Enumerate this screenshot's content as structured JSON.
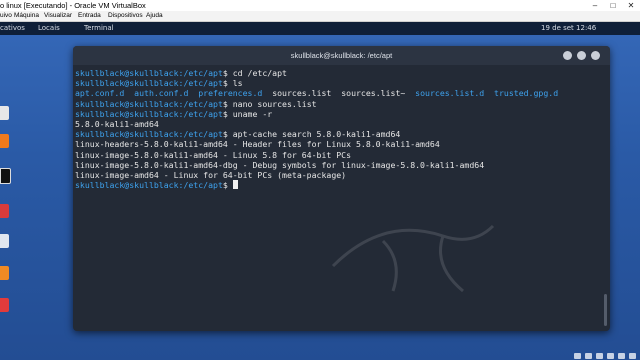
{
  "vbox": {
    "title": "o linux [Executando] - Oracle VM VirtualBox",
    "controls": [
      "–",
      "□",
      "✕"
    ],
    "menu": [
      "uivo",
      "Máquina",
      "Visualizar",
      "Entrada",
      "Dispositivos",
      "Ajuda"
    ]
  },
  "panel": {
    "left_items": [
      "cativos",
      "Locais",
      "Terminal"
    ],
    "clock": "19 de set  12:46"
  },
  "terminal": {
    "title": "skullblack@skullblack: /etc/apt",
    "lines": [
      {
        "user": "skullblack@skullblack",
        "path": ":/etc/apt",
        "cmd": "$ cd /etc/apt"
      },
      {
        "user": "skullblack@skullblack",
        "path": ":/etc/apt",
        "cmd": "$ ls"
      },
      {
        "ls": [
          {
            "text": "apt.conf.d",
            "dir": true
          },
          {
            "text": "auth.conf.d",
            "dir": true
          },
          {
            "text": "preferences.d",
            "dir": true
          },
          {
            "text": "sources.list",
            "dir": false
          },
          {
            "text": "sources.list~",
            "dir": false
          },
          {
            "text": "sources.list.d",
            "dir": true
          },
          {
            "text": "trusted.gpg.d",
            "dir": true
          }
        ]
      },
      {
        "user": "skullblack@skullblack",
        "path": ":/etc/apt",
        "cmd": "$ nano sources.list"
      },
      {
        "user": "skullblack@skullblack",
        "path": ":/etc/apt",
        "cmd": "$ uname -r"
      },
      {
        "out": "5.8.0-kali1-amd64"
      },
      {
        "user": "skullblack@skullblack",
        "path": ":/etc/apt",
        "cmd": "$ apt-cache search 5.8.0-kali1-amd64"
      },
      {
        "out": "linux-headers-5.8.0-kali1-amd64 - Header files for Linux 5.8.0-kali1-amd64"
      },
      {
        "out": "linux-image-5.8.0-kali1-amd64 - Linux 5.8 for 64-bit PCs"
      },
      {
        "out": "linux-image-5.8.0-kali1-amd64-dbg - Debug symbols for linux-image-5.8.0-kali1-amd64"
      },
      {
        "out": "linux-image-amd64 - Linux for 64-bit PCs (meta-package)"
      },
      {
        "user": "skullblack@skullblack",
        "path": ":/etc/apt",
        "cmd": "$ ",
        "cursor": true
      }
    ]
  },
  "colors": {
    "prompt": "#3ea2ee",
    "terminal_bg": "#232a36",
    "desktop": "#2a5aa6"
  },
  "icons": [
    "close-icon",
    "maximize-icon",
    "minimize-icon",
    "kali-dragon-icon"
  ]
}
